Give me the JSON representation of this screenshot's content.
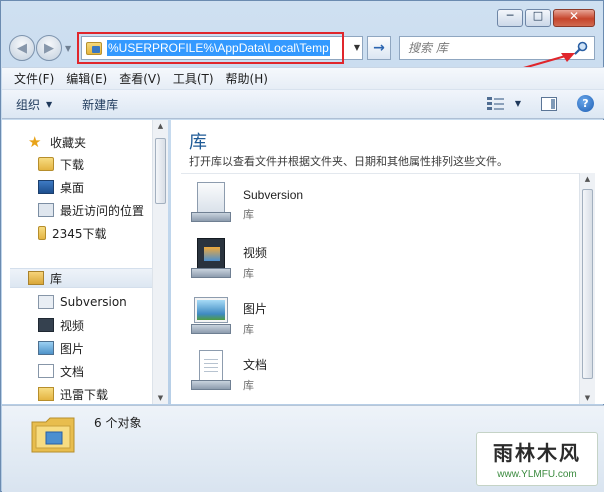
{
  "window": {
    "caption": {
      "minimize": "─",
      "maximize": "□",
      "close": "✕"
    },
    "nav": {
      "back": "◀",
      "forward": "▶",
      "recent": "▼"
    }
  },
  "address": {
    "path": "%USERPROFILE%\\AppData\\Local\\Temp",
    "go": "→"
  },
  "search": {
    "placeholder": "搜索 库"
  },
  "menu": [
    "文件(F)",
    "编辑(E)",
    "查看(V)",
    "工具(T)",
    "帮助(H)"
  ],
  "toolbar": {
    "organize": "组织",
    "new_library": "新建库",
    "help": "?"
  },
  "navpane": {
    "favorites": {
      "title": "收藏夹",
      "items": [
        "下载",
        "桌面",
        "最近访问的位置",
        "2345下载"
      ]
    },
    "libraries": {
      "title": "库",
      "items": [
        "Subversion",
        "视频",
        "图片",
        "文档",
        "迅雷下载"
      ]
    }
  },
  "content": {
    "title": "库",
    "description": "打开库以查看文件并根据文件夹、日期和其他属性排列这些文件。",
    "items": [
      {
        "name": "Subversion",
        "kind": "库",
        "icon": "subversion-library-icon"
      },
      {
        "name": "视频",
        "kind": "库",
        "icon": "videos-library-icon"
      },
      {
        "name": "图片",
        "kind": "库",
        "icon": "pictures-library-icon"
      },
      {
        "name": "文档",
        "kind": "库",
        "icon": "documents-library-icon"
      }
    ]
  },
  "status": {
    "count": "6 个对象"
  },
  "watermark": {
    "title": "雨林木风",
    "url": "www.YLMFU.com"
  },
  "colors": {
    "highlight_border": "#e0262c",
    "selection": "#3399ff",
    "title_blue": "#1e5a96"
  }
}
